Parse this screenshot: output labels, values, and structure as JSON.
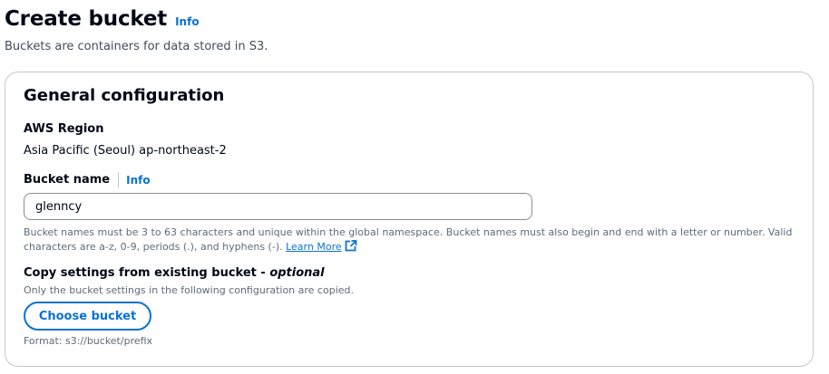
{
  "header": {
    "title": "Create bucket",
    "info_label": "Info",
    "description": "Buckets are containers for data stored in S3."
  },
  "general_config": {
    "title": "General configuration",
    "region": {
      "label": "AWS Region",
      "value": "Asia Pacific (Seoul) ap-northeast-2"
    },
    "bucket_name": {
      "label": "Bucket name",
      "info_label": "Info",
      "value": "glenncy",
      "constraint_text": "Bucket names must be 3 to 63 characters and unique within the global namespace. Bucket names must also begin and end with a letter or number. Valid characters are a-z, 0-9, periods (.), and hyphens (-).",
      "learn_more_label": "Learn More",
      "learn_more_icon": "external-link-icon"
    },
    "copy_settings": {
      "title": "Copy settings from existing bucket - ",
      "optional_label": "optional",
      "description": "Only the bucket settings in the following configuration are copied.",
      "button_label": "Choose bucket",
      "format_hint": "Format: s3://bucket/prefix"
    }
  },
  "colors": {
    "link": "#0972d3",
    "text": "#000716",
    "secondary_text": "#5f6b7a",
    "border": "#c6c6cd"
  }
}
